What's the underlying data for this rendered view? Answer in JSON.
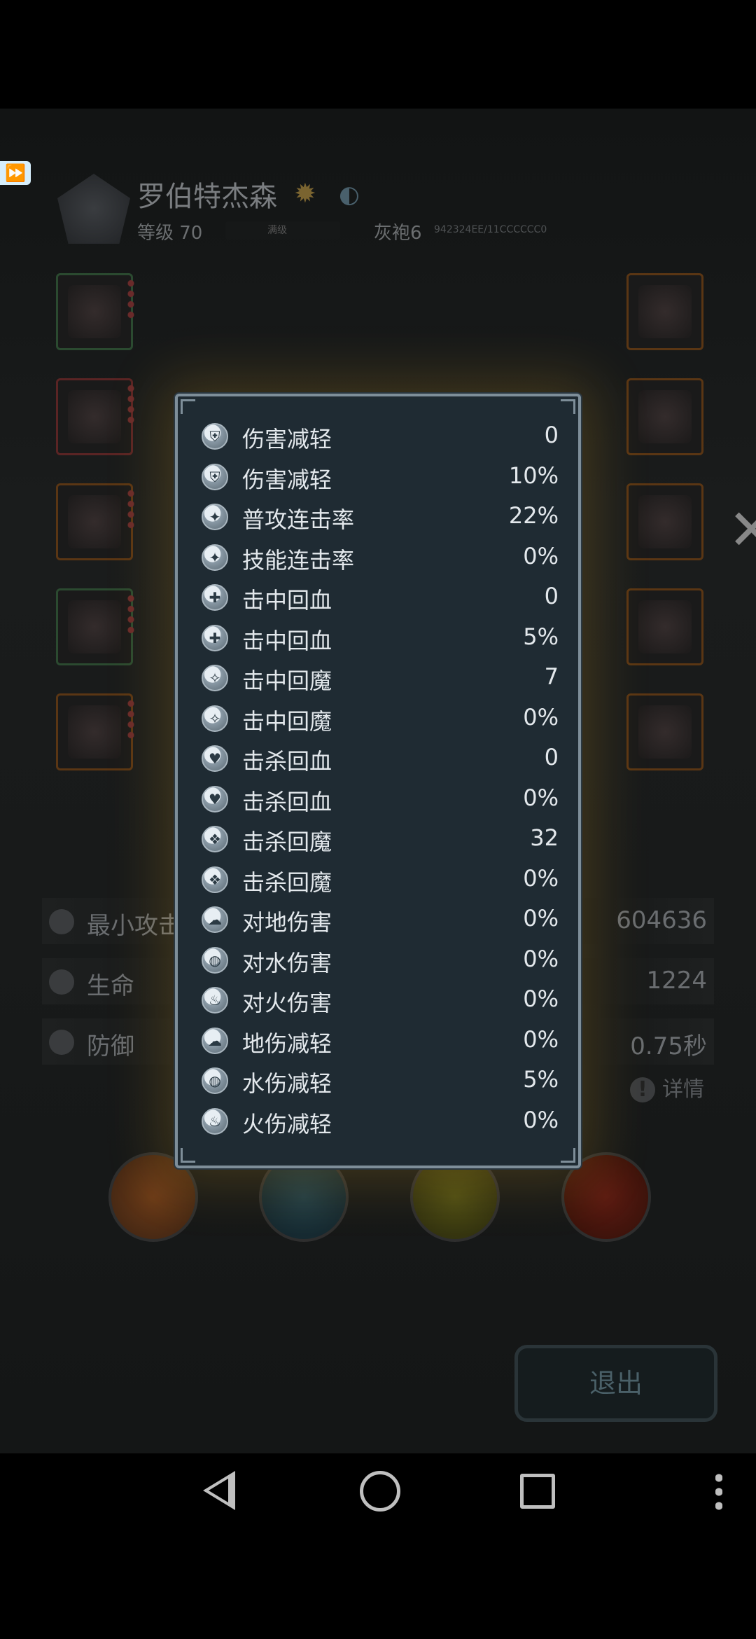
{
  "character": {
    "name": "罗伯特杰森",
    "level_label": "等级 70",
    "level_bar_text": "满级",
    "rank": "灰袍6",
    "uid": "942324EE/11CCCCCC0"
  },
  "ad_badge_icon": "fast-forward-icon",
  "stats": [
    {
      "label": "最小攻击",
      "value": "604636",
      "icon": "sword-icon"
    },
    {
      "label": "生命",
      "value": "1224",
      "icon": "heart-icon"
    },
    {
      "label": "防御",
      "value": "0.75秒",
      "icon": "shield-icon"
    }
  ],
  "detail_label": "详情",
  "exit_label": "退出",
  "modal": {
    "rows": [
      {
        "label": "伤害减轻",
        "value": "0"
      },
      {
        "label": "伤害减轻",
        "value": "10%"
      },
      {
        "label": "普攻连击率",
        "value": "22%"
      },
      {
        "label": "技能连击率",
        "value": "0%"
      },
      {
        "label": "击中回血",
        "value": "0"
      },
      {
        "label": "击中回血",
        "value": "5%"
      },
      {
        "label": "击中回魔",
        "value": "7"
      },
      {
        "label": "击中回魔",
        "value": "0%"
      },
      {
        "label": "击杀回血",
        "value": "0"
      },
      {
        "label": "击杀回血",
        "value": "0%"
      },
      {
        "label": "击杀回魔",
        "value": "32"
      },
      {
        "label": "击杀回魔",
        "value": "0%"
      },
      {
        "label": "对地伤害",
        "value": "0%"
      },
      {
        "label": "对水伤害",
        "value": "0%"
      },
      {
        "label": "对火伤害",
        "value": "0%"
      },
      {
        "label": "地伤减轻",
        "value": "0%"
      },
      {
        "label": "水伤减轻",
        "value": "5%"
      },
      {
        "label": "火伤减轻",
        "value": "0%"
      }
    ]
  },
  "navbar": {
    "back_icon": "back-triangle-icon",
    "home_icon": "home-circle-icon",
    "recent_icon": "recent-square-icon",
    "more_icon": "more-dots-icon"
  }
}
